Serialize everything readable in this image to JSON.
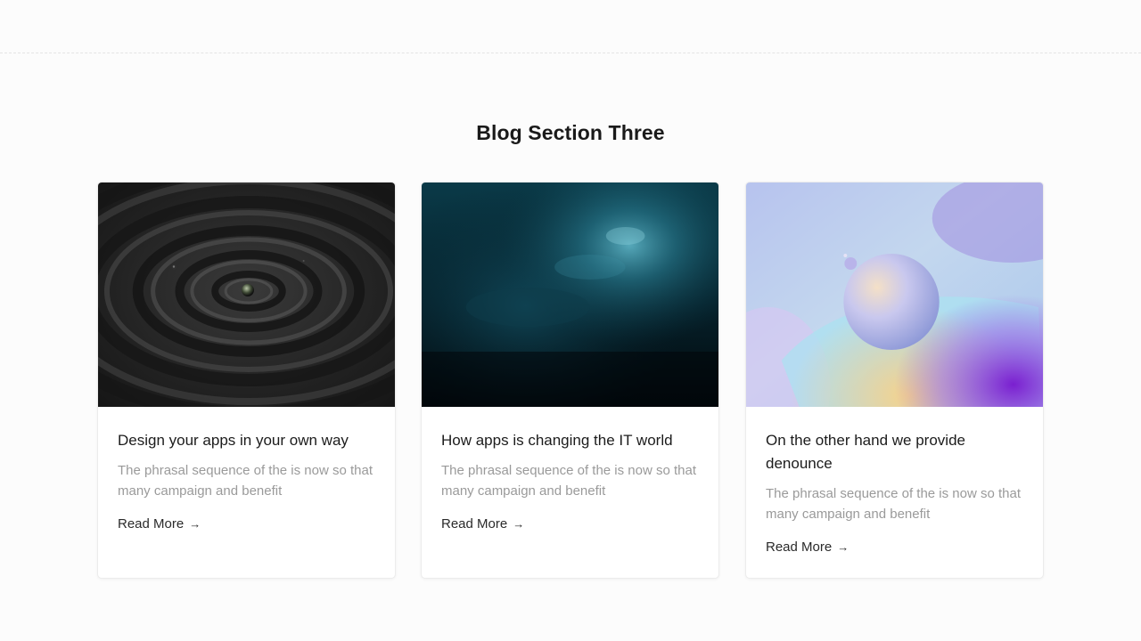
{
  "section": {
    "title": "Blog Section Three"
  },
  "posts": [
    {
      "title": "Design your apps in your own way",
      "excerpt": "The phrasal sequence of the is now so that many campaign and benefit",
      "read_more": "Read More",
      "arrow": "→",
      "image": "dark-ripple-sphere-image"
    },
    {
      "title": "How apps is changing the IT world",
      "excerpt": "The phrasal sequence of the is now so that many campaign and benefit",
      "read_more": "Read More",
      "arrow": "→",
      "image": "teal-nebula-image"
    },
    {
      "title": "On the other hand we provide denounce",
      "excerpt": "The phrasal sequence of the is now so that many campaign and benefit",
      "read_more": "Read More",
      "arrow": "→",
      "image": "pastel-3d-sphere-image"
    }
  ],
  "colors": {
    "background": "#fcfcfc",
    "card": "#ffffff",
    "title_text": "#1a1a1a",
    "excerpt_text": "#9a9a9a"
  }
}
